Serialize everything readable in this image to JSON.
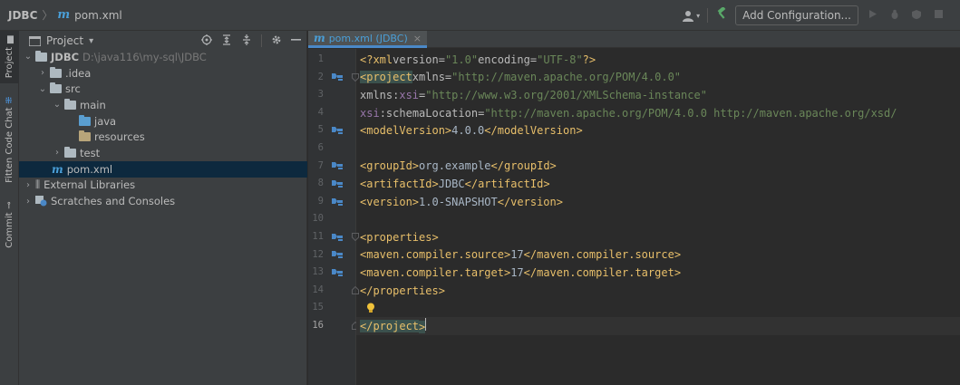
{
  "titlebar": {
    "project": "JDBC",
    "separator": "〉",
    "file_icon": "m",
    "file": "pom.xml",
    "add_configuration": "Add Configuration...",
    "icons": [
      "user-icon",
      "hammer-icon",
      "run-icon",
      "debug-icon",
      "coverage-icon",
      "stop-icon"
    ]
  },
  "strip": {
    "tabs": [
      "Project",
      "Fitten Code Chat",
      "Commit"
    ]
  },
  "project_panel": {
    "title": "Project",
    "dropdown": "▾",
    "tools": [
      "locate-icon",
      "expand-all-icon",
      "collapse-all-icon",
      "gear-icon",
      "minimize-icon"
    ],
    "tree": [
      {
        "label": "JDBC",
        "path": "D:\\java116\\my-sql\\JDBC",
        "depth": 0,
        "arrow": "⌄",
        "icon": "module-folder"
      },
      {
        "label": ".idea",
        "depth": 1,
        "arrow": "›",
        "icon": "folder"
      },
      {
        "label": "src",
        "depth": 1,
        "arrow": "⌄",
        "icon": "folder"
      },
      {
        "label": "main",
        "depth": 2,
        "arrow": "⌄",
        "icon": "folder"
      },
      {
        "label": "java",
        "depth": 3,
        "arrow": "",
        "icon": "source-folder"
      },
      {
        "label": "resources",
        "depth": 3,
        "arrow": "",
        "icon": "resources-folder"
      },
      {
        "label": "test",
        "depth": 2,
        "arrow": "›",
        "icon": "folder"
      },
      {
        "label": "pom.xml",
        "depth": 1,
        "arrow": "",
        "icon": "maven-file",
        "selected": true
      },
      {
        "label": "External Libraries",
        "depth": 0,
        "arrow": "›",
        "icon": "library"
      },
      {
        "label": "Scratches and Consoles",
        "depth": 0,
        "arrow": "›",
        "icon": "scratches"
      }
    ]
  },
  "editor": {
    "tab_icon": "m",
    "tab_label": "pom.xml (JDBC)",
    "tab_close": "×",
    "current_line": 16,
    "lines": [
      {
        "n": "1",
        "text": "<?xml version=\"1.0\" encoding=\"UTF-8\"?>"
      },
      {
        "n": "2",
        "text": "<project xmlns=\"http://maven.apache.org/POM/4.0.0\""
      },
      {
        "n": "3",
        "text": "         xmlns:xsi=\"http://www.w3.org/2001/XMLSchema-instance\""
      },
      {
        "n": "4",
        "text": "         xsi:schemaLocation=\"http://maven.apache.org/POM/4.0.0 http://maven.apache.org/xsd/"
      },
      {
        "n": "5",
        "text": "    <modelVersion>4.0.0</modelVersion>"
      },
      {
        "n": "6",
        "text": ""
      },
      {
        "n": "7",
        "text": "    <groupId>org.example</groupId>"
      },
      {
        "n": "8",
        "text": "    <artifactId>JDBC</artifactId>"
      },
      {
        "n": "9",
        "text": "    <version>1.0-SNAPSHOT</version>"
      },
      {
        "n": "10",
        "text": ""
      },
      {
        "n": "11",
        "text": "    <properties>"
      },
      {
        "n": "12",
        "text": "        <maven.compiler.source>17</maven.compiler.source>"
      },
      {
        "n": "13",
        "text": "        <maven.compiler.target>17</maven.compiler.target>"
      },
      {
        "n": "14",
        "text": "    </properties>"
      },
      {
        "n": "15",
        "text": ""
      },
      {
        "n": "16",
        "text": "</project>"
      }
    ],
    "gutter_marks": {
      "2": "maven-icon",
      "5": "maven-icon",
      "7": "maven-icon",
      "8": "maven-icon",
      "9": "maven-icon",
      "11": "maven-icon",
      "12": "maven-icon",
      "13": "maven-icon"
    },
    "folds": {
      "2": "fold-open",
      "11": "fold-open",
      "14": "fold-close",
      "16": "fold-close"
    },
    "bulb_line": 15
  },
  "colors": {
    "tag": "#e8bf6a",
    "attribute": "#bababa",
    "value": "#6a8759",
    "namespace": "#9876aa",
    "text": "#a9b7c6",
    "selection": "#0d293e",
    "accent": "#4a88c7"
  }
}
